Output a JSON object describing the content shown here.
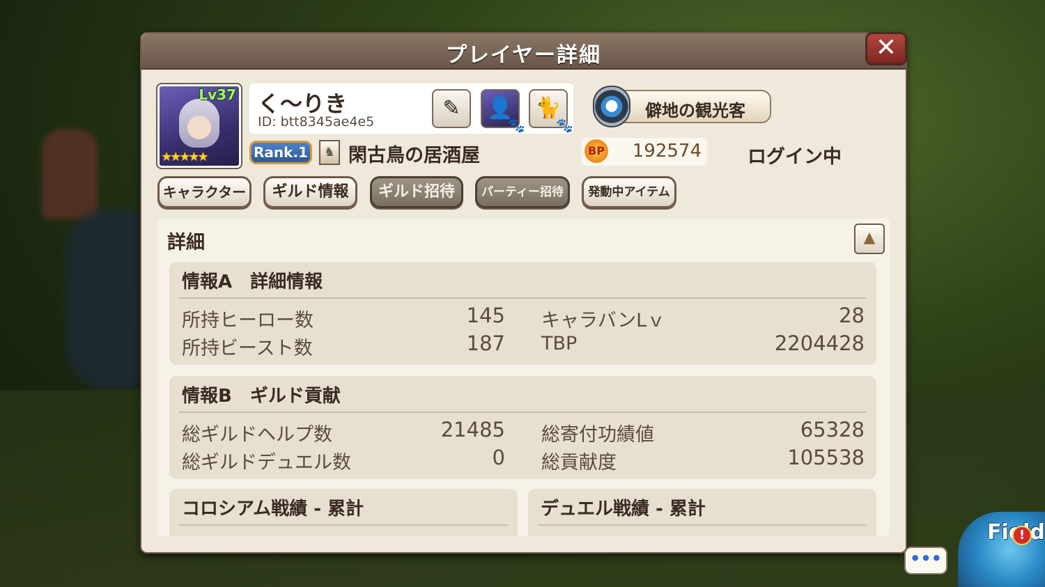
{
  "dialog": {
    "title": "プレイヤー詳細",
    "close_label": "✕"
  },
  "player": {
    "name": "く～りき",
    "id_text": "ID: btt8345ae4e5",
    "level": "Lv37",
    "stars": "★★★★★",
    "rank": "Rank.1",
    "guild_name": "閑古鳥の居酒屋",
    "bp_label": "BP",
    "bp_value": "192574",
    "status": "ログイン中",
    "title_badge": "僻地の観光客"
  },
  "tabs": [
    {
      "label": "キャラクター",
      "style": "light"
    },
    {
      "label": "ギルド情報",
      "style": "light"
    },
    {
      "label": "ギルド招待",
      "style": "dark"
    },
    {
      "label": "パーティー招待",
      "style": "dark"
    },
    {
      "label": "発動中アイテム",
      "style": "light"
    }
  ],
  "details": {
    "heading": "詳細",
    "info_a": {
      "title": "情報A　詳細情報",
      "stats": [
        {
          "label": "所持ヒーロー数",
          "value": "145"
        },
        {
          "label": "キャラバンLｖ",
          "value": "28"
        },
        {
          "label": "所持ビースト数",
          "value": "187"
        },
        {
          "label": "TBP",
          "value": "2204428"
        }
      ]
    },
    "info_b": {
      "title": "情報B　ギルド貢献",
      "stats": [
        {
          "label": "総ギルドヘルプ数",
          "value": "21485"
        },
        {
          "label": "総寄付功績値",
          "value": "65328"
        },
        {
          "label": "総ギルドデュエル数",
          "value": "0"
        },
        {
          "label": "総貢献度",
          "value": "105538"
        }
      ]
    },
    "colosseum_title": "コロシアム戦績 - 累計",
    "duel_title": "デュエル戦績 - 累計"
  },
  "hud": {
    "chat_label": "•••",
    "field_label": "Field",
    "alert_label": "!"
  },
  "colors": {
    "dialog_bg": "#efe9dc",
    "title_bar": "#6a574a",
    "rank_bg": "#2c5a9a",
    "close_bg": "#7c2620"
  }
}
